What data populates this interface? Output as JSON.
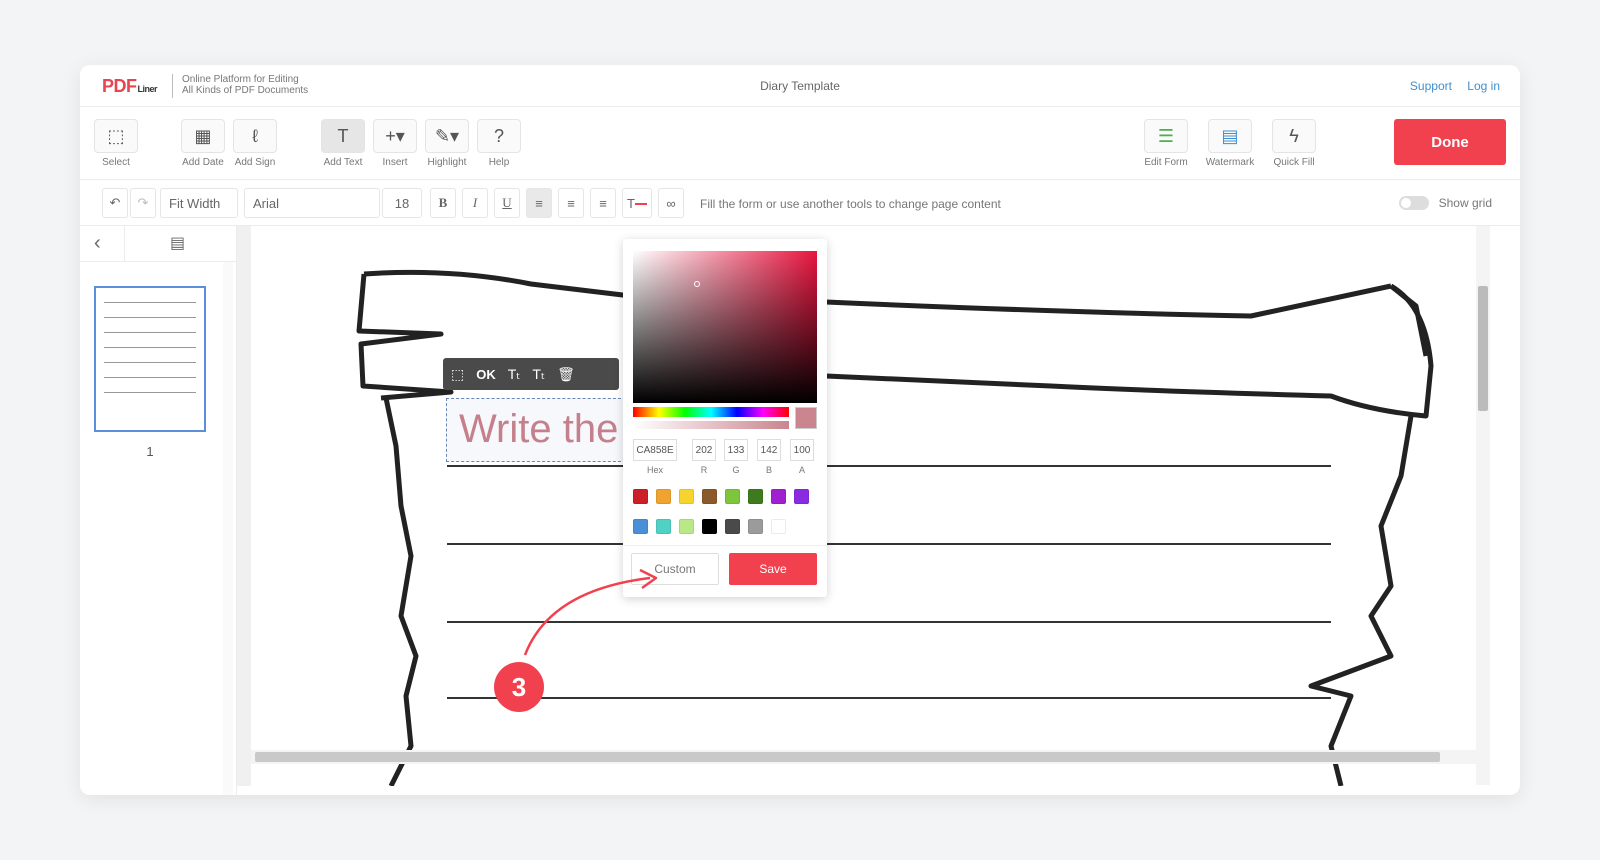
{
  "header": {
    "logo_main": "PDF",
    "logo_sub": "Liner",
    "tagline_line1": "Online Platform for Editing",
    "tagline_line2": "All Kinds of PDF Documents",
    "doc_title": "Diary Template",
    "support_label": "Support",
    "login_label": "Log in"
  },
  "toolbar": {
    "select": "Select",
    "add_date": "Add Date",
    "add_sign": "Add Sign",
    "add_text": "Add Text",
    "insert": "Insert",
    "highlight": "Highlight",
    "help": "Help",
    "edit_form": "Edit Form",
    "watermark": "Watermark",
    "quick_fill": "Quick Fill",
    "done": "Done"
  },
  "formatbar": {
    "zoom": "Fit Width",
    "font": "Arial",
    "size": "18",
    "bold": "B",
    "italic": "I",
    "underline": "U",
    "hint": "Fill the form or use another tools to change page content",
    "show_grid": "Show grid"
  },
  "sidebar": {
    "page_number": "1"
  },
  "text_toolbar": {
    "ok": "OK"
  },
  "text_box": {
    "content": "Write the t"
  },
  "color_picker": {
    "hex": "CA858E",
    "r": "202",
    "g": "133",
    "b": "142",
    "a": "100",
    "hex_label": "Hex",
    "r_label": "R",
    "g_label": "G",
    "b_label": "B",
    "a_label": "A",
    "selected_color": "#ca858e",
    "swatches": [
      "#cc1f27",
      "#f0a330",
      "#f6d32d",
      "#8b5a2b",
      "#7dc53a",
      "#3e7b1f",
      "#a020d0",
      "#8a2be2",
      "#4a90d9",
      "#4fd1c5",
      "#b8e986",
      "#000000",
      "#4a4a4a",
      "#9b9b9b",
      "#ffffff"
    ],
    "custom_label": "Custom",
    "save_label": "Save"
  },
  "annotation": {
    "step": "3"
  },
  "colors": {
    "accent": "#f2414e",
    "link": "#3d8fd1"
  }
}
